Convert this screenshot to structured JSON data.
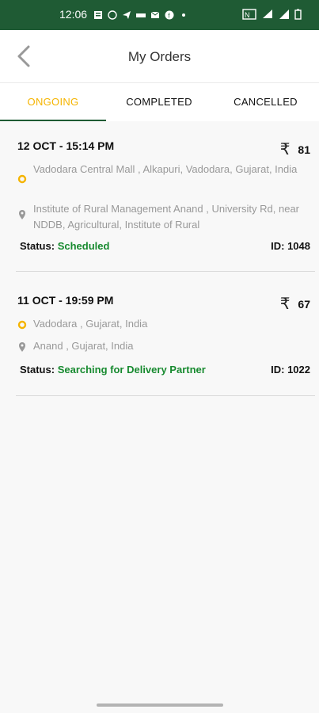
{
  "status_bar": {
    "time": "12:06"
  },
  "header": {
    "title": "My Orders"
  },
  "tabs": [
    {
      "label": "ONGOING",
      "active": true
    },
    {
      "label": "COMPLETED",
      "active": false
    },
    {
      "label": "CANCELLED",
      "active": false
    }
  ],
  "orders": [
    {
      "date": "12 OCT - 15:14 PM",
      "currency": "₹",
      "amount": "81",
      "pickup": "Vadodara Central Mall , Alkapuri, Vadodara, Gujarat, India",
      "drop": "Institute of Rural Management Anand , University Rd, near NDDB, Agricultural, Institute of Rural",
      "status_label": "Status:",
      "status_value": "Scheduled",
      "id_label": "ID:",
      "id_value": "1048"
    },
    {
      "date": "11 OCT - 19:59 PM",
      "currency": "₹",
      "amount": "67",
      "pickup": "Vadodara , Gujarat, India",
      "drop": "Anand , Gujarat, India",
      "status_label": "Status:",
      "status_value": "Searching for Delivery Partner",
      "id_label": "ID:",
      "id_value": "1022"
    }
  ],
  "colors": {
    "primary": "#1f5b34",
    "accent": "#f5b400",
    "status_green": "#178a2f"
  }
}
